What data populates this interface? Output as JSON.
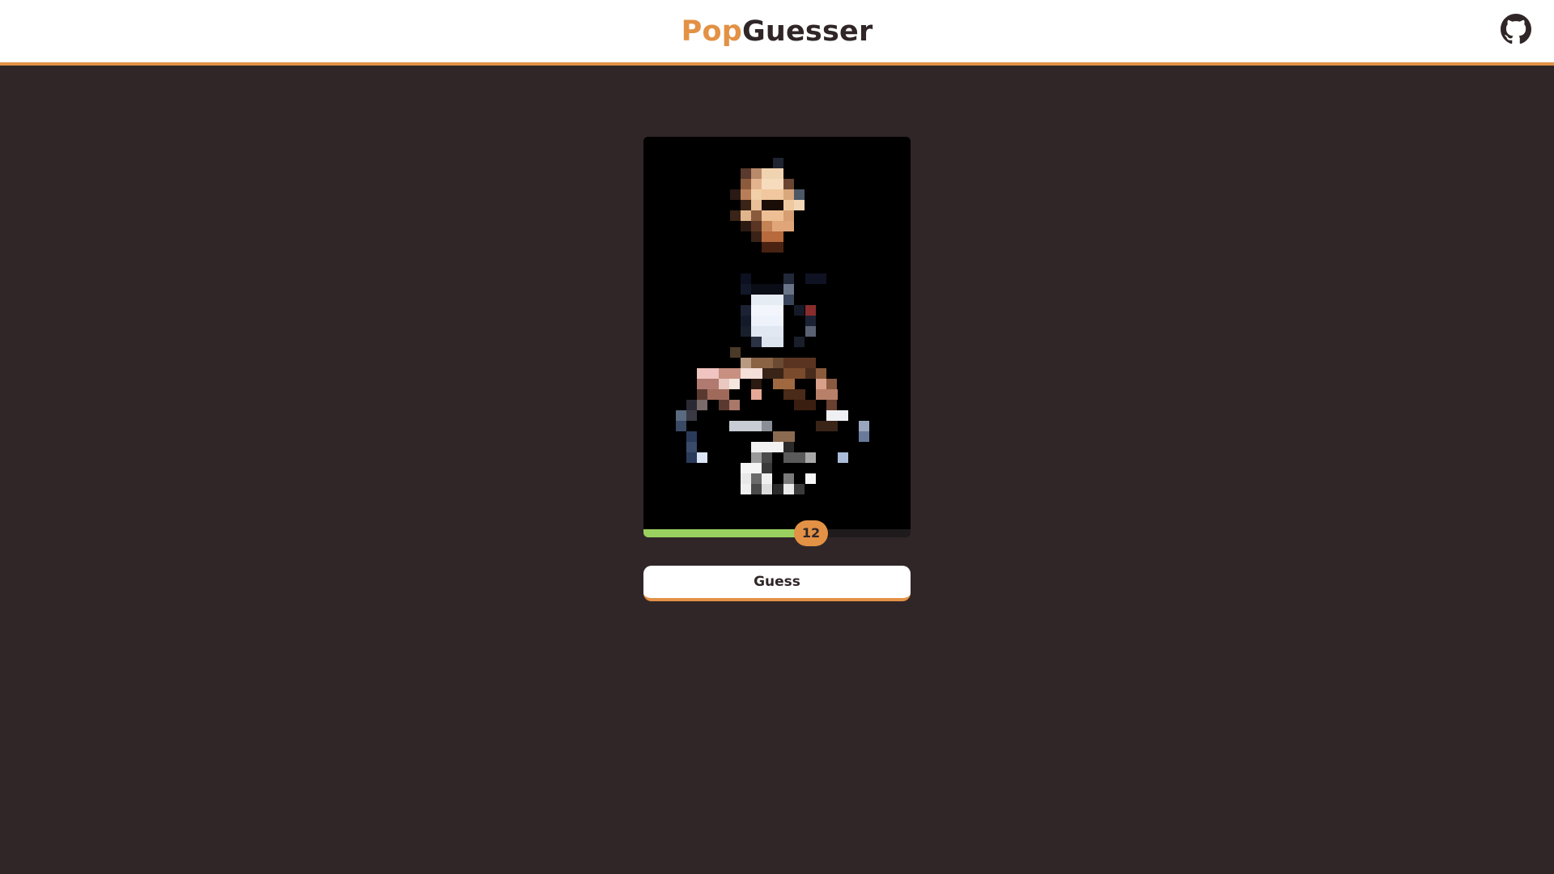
{
  "header": {
    "logo_part1": "Pop",
    "logo_part2": "Guesser",
    "github_icon": "github-icon"
  },
  "game": {
    "timer_value": "12",
    "time_progress_percent": 57,
    "guess_label": "Guess"
  },
  "colors": {
    "accent": "#e39145",
    "background": "#302628",
    "progress": "#99d05f",
    "header_bg": "#ffffff"
  }
}
